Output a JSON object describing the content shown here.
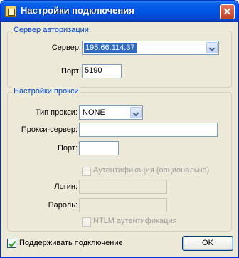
{
  "window": {
    "title": "Настройки подключения",
    "close_glyph": "✕",
    "icon": "app-icon"
  },
  "auth_group": {
    "title": "Сервер авторизации",
    "server_label": "Сервер:",
    "server_value": "195.66.114.37",
    "port_label": "Порт:",
    "port_value": "5190"
  },
  "proxy_group": {
    "title": "Настройки прокси",
    "type_label": "Тип прокси:",
    "type_value": "NONE",
    "server_label": "Прокси-сервер:",
    "server_value": "",
    "port_label": "Порт:",
    "port_value": "",
    "auth_checkbox_label": "Аутентификация (опционально)",
    "login_label": "Логин:",
    "login_value": "",
    "password_label": "Пароль:",
    "password_value": "",
    "ntlm_checkbox_label": "NTLM аутентификация"
  },
  "footer": {
    "keepalive_label": "Поддерживать подключение",
    "keepalive_checked": true,
    "ok_label": "OK"
  }
}
